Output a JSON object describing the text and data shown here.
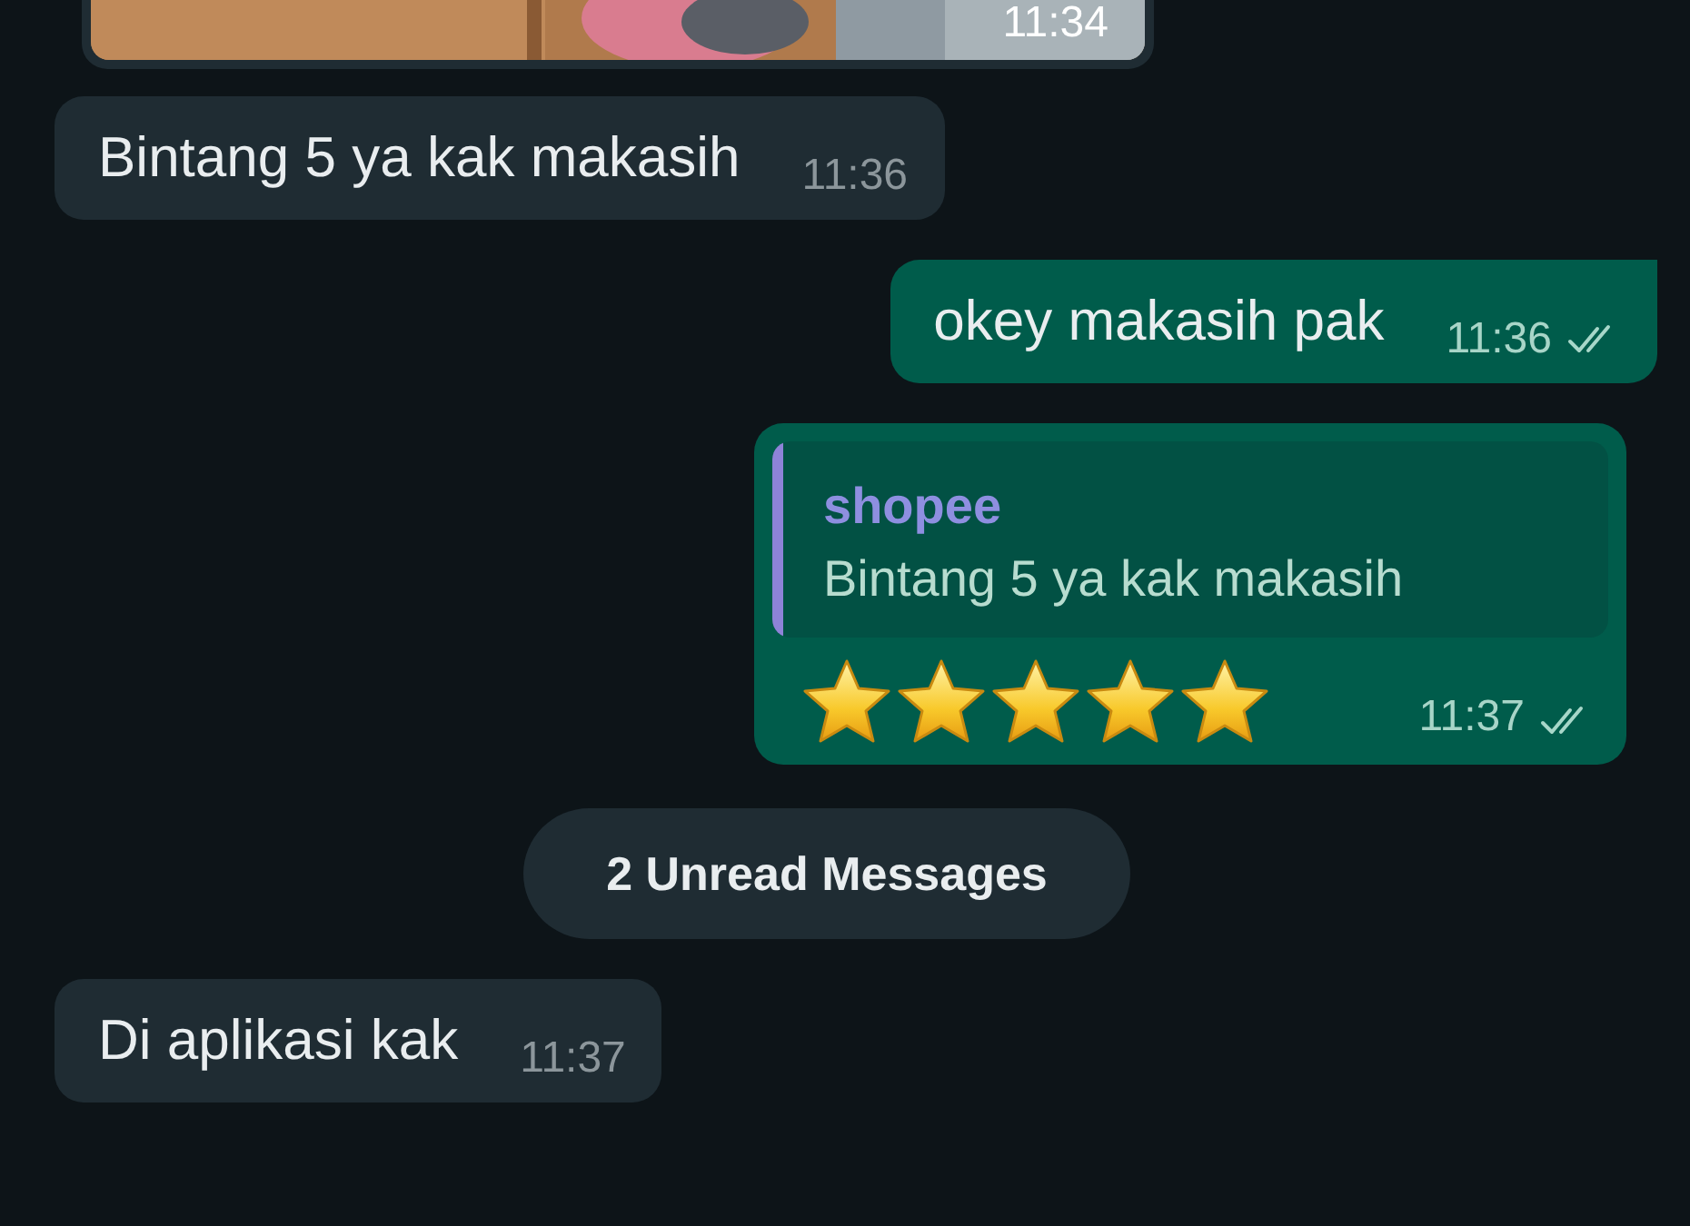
{
  "messages": [
    {
      "outgoing": false,
      "time": "11:34"
    },
    {
      "kind": "text",
      "outgoing": false,
      "text": "Bintang 5 ya kak makasih",
      "time": "11:36"
    },
    {
      "kind": "text",
      "outgoing": true,
      "text": "okey makasih pak",
      "time": "11:36",
      "read": false
    },
    {
      "kind": "reply",
      "outgoing": true,
      "quote_author": "shopee",
      "quote_text": "Bintang 5 ya kak makasih",
      "stars": 5,
      "time": "11:37",
      "read": false
    },
    {
      "kind": "divider",
      "text": "2 Unread Messages"
    },
    {
      "kind": "text",
      "outgoing": false,
      "text": "Di aplikasi kak",
      "time": "11:37"
    }
  ]
}
